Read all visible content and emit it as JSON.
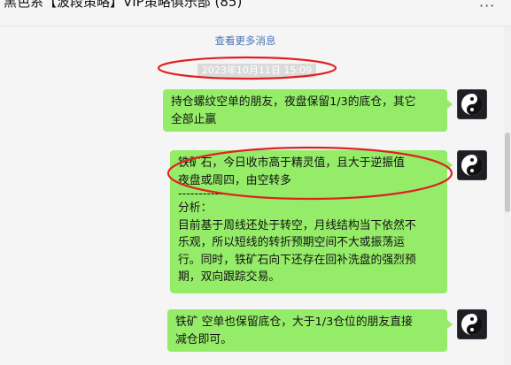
{
  "window": {
    "title": "黑色系【波段策略】VIP策略俱乐部 (85)",
    "more_icon": "more-dots-icon"
  },
  "chat": {
    "load_more": "查看更多消息",
    "timestamp": "2023年10月11日 15:09",
    "messages": [
      {
        "sender": "self",
        "avatar": "yin-yang-icon",
        "lines": [
          "持仓螺纹空单的朋友，夜盘保留1/3的底仓，其它",
          "全部止赢"
        ]
      },
      {
        "sender": "self",
        "avatar": "yin-yang-icon",
        "lines": [
          "铁矿石，今日收市高于精灵值，且大于逆振值",
          "夜盘或周四，由空转多",
          "------------",
          "分析：",
          "目前基于周线还处于转空，月线结构当下依然不",
          "乐观，所以短线的转折预期空间不大或振荡运",
          "行。同时，铁矿石向下还存在回补洗盘的强烈预",
          "期，双向跟踪交易。"
        ]
      },
      {
        "sender": "self",
        "avatar": "yin-yang-icon",
        "lines": [
          "铁矿  空单也保留底仓，大于1/3仓位的朋友直接",
          "减仓即可。"
        ]
      }
    ]
  },
  "annotations": {
    "color": "#e02020"
  },
  "colors": {
    "bubble": "#95ec69",
    "background": "#f5f5f5",
    "link": "#4a72b6"
  }
}
